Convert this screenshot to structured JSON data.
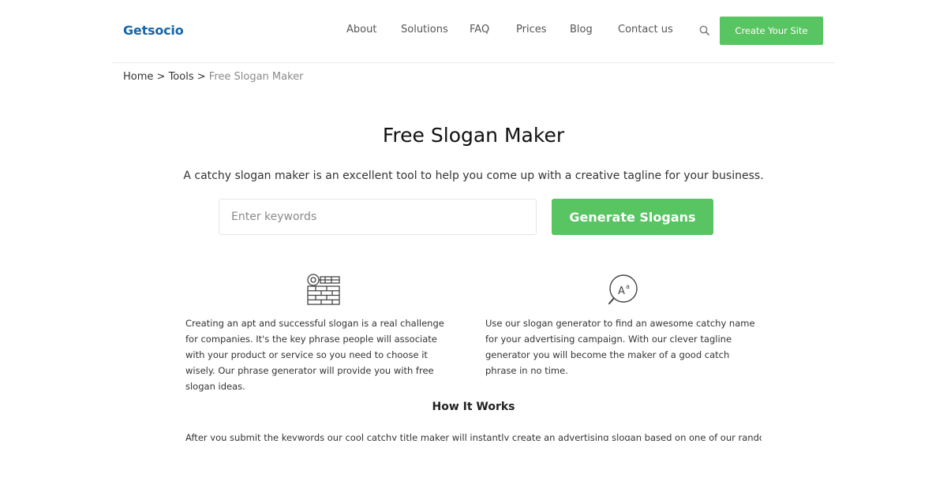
{
  "header": {
    "logo": "Getsocio",
    "nav": [
      {
        "label": "About"
      },
      {
        "label": "Solutions"
      },
      {
        "label": "FAQ"
      },
      {
        "label": "Prices"
      },
      {
        "label": "Blog"
      },
      {
        "label": "Contact us"
      }
    ],
    "search_icon": "search-icon",
    "cta_label": "Create Your Site"
  },
  "breadcrumb": {
    "home": "Home",
    "sep1": ">",
    "tools": "Tools",
    "sep2": ">",
    "current": "Free Slogan Maker"
  },
  "main": {
    "title": "Free Slogan Maker",
    "subtitle": "A catchy slogan maker is an excellent tool to help you come up with a creative tagline for your business.",
    "input_placeholder": "Enter keywords",
    "input_value": "",
    "generate_label": "Generate Slogans"
  },
  "features": [
    {
      "icon": "keyword-wall-icon",
      "text": "Creating an apt and successful slogan is a real challenge for companies. It's the key phrase people will associate with your product or service so you need to choose it wisely. Our phrase generator will provide you with free slogan ideas."
    },
    {
      "icon": "font-search-icon",
      "text": "Use our slogan generator to find an awesome catchy name for your advertising campaign. With our clever tagline generator you will become the maker of a good catch phrase in no time."
    }
  ],
  "how_it_works": {
    "title": "How It Works",
    "text": "After you submit the keywords our cool catchy title maker will instantly create an advertising slogan based on one of our random templates."
  },
  "colors": {
    "brand": "#1565a8",
    "accent_green": "#58c462"
  }
}
